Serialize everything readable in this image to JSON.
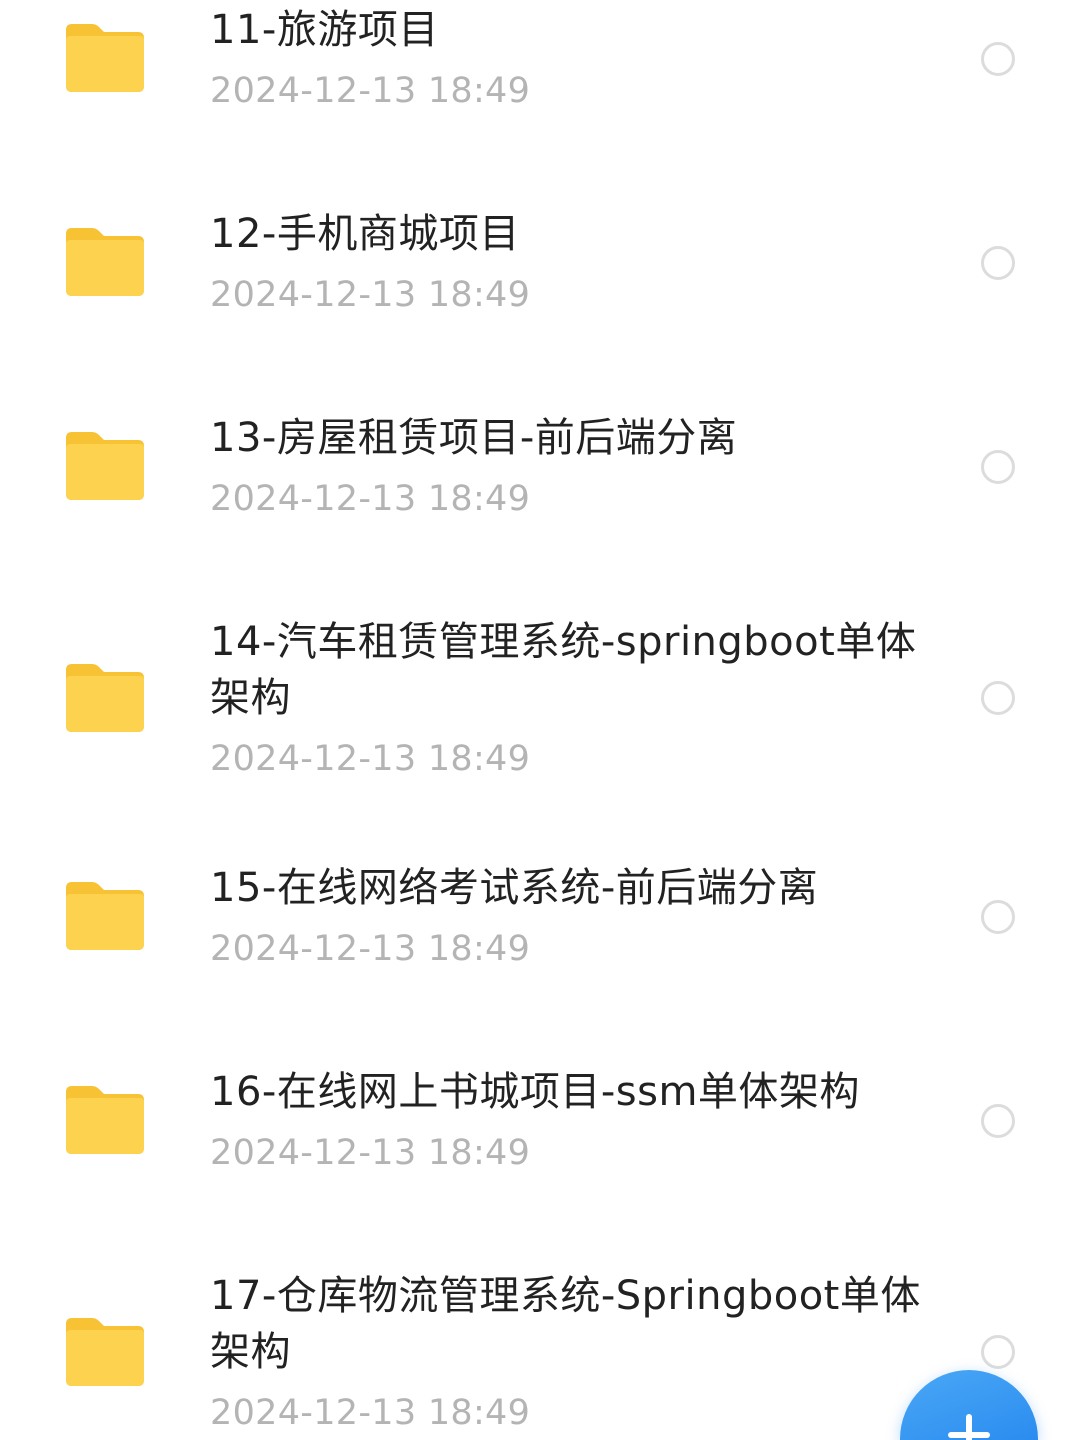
{
  "colors": {
    "folder_body": "#fdd24e",
    "folder_tab": "#f7c233",
    "name_text": "#222222",
    "date_text": "#b4b4b4",
    "fab": "#2b8cf0"
  },
  "items": [
    {
      "name": "11-旅游项目",
      "date": "2024-12-13  18:49"
    },
    {
      "name": "12-手机商城项目",
      "date": "2024-12-13  18:49"
    },
    {
      "name": "13-房屋租赁项目-前后端分离",
      "date": "2024-12-13  18:49"
    },
    {
      "name": "14-汽车租赁管理系统-springboot单体架构",
      "date": "2024-12-13  18:49"
    },
    {
      "name": "15-在线网络考试系统-前后端分离",
      "date": "2024-12-13  18:49"
    },
    {
      "name": "16-在线网上书城项目-ssm单体架构",
      "date": "2024-12-13  18:49"
    },
    {
      "name": "17-仓库物流管理系统-Springboot单体架构",
      "date": "2024-12-13  18:49"
    }
  ],
  "icons": {
    "folder": "folder-icon",
    "select": "radio-unchecked-icon",
    "fab": "plus-icon"
  }
}
